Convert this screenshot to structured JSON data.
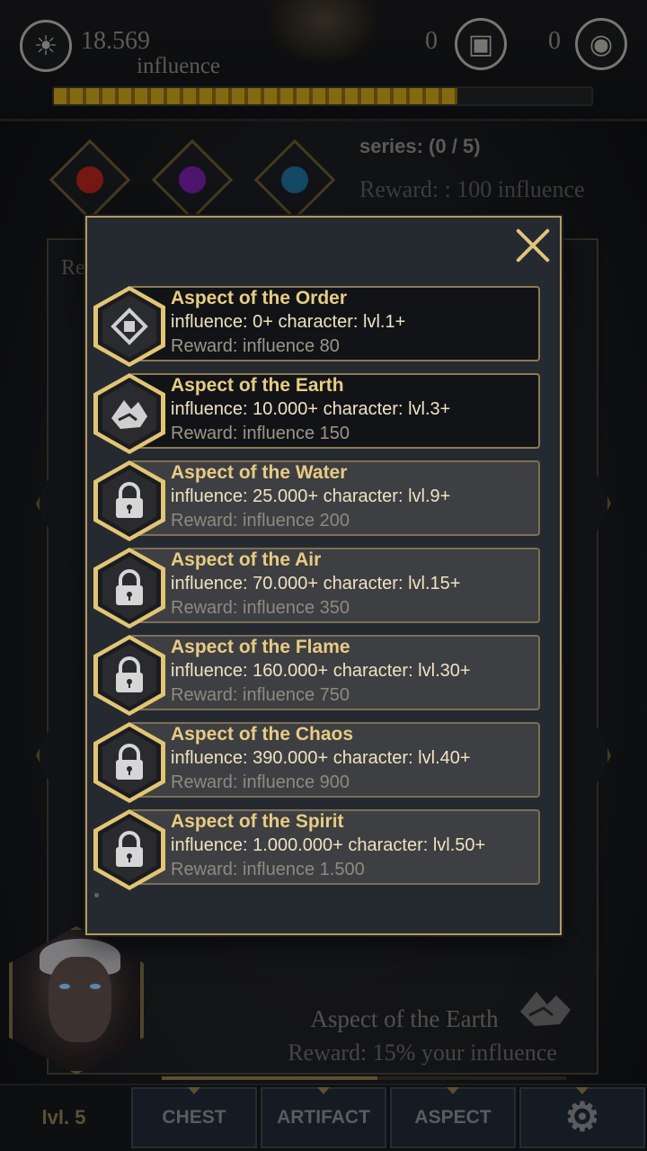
{
  "header": {
    "influence_value": "18.569",
    "influence_label": "influence",
    "chest_count": "0",
    "eye_count": "0",
    "progress": 0.75
  },
  "series": {
    "text": "series: (0 / 5)",
    "reward": "Reward: : 100 influence"
  },
  "background": {
    "aspect_name": "Aspect of the Earth",
    "aspect_reward": "Reward:  15% your influence",
    "panel_label_fragment": "Re"
  },
  "nav": {
    "level": "lvl. 5",
    "chest": "CHEST",
    "artifact": "ARTIFACT",
    "aspect": "ASPECT"
  },
  "modal": {
    "aspects": [
      {
        "title": "Aspect of the Order",
        "req": "influence: 0+ character: lvl.1+",
        "reward": "Reward: influence 80",
        "icon": "order-icon",
        "locked": false
      },
      {
        "title": "Aspect of the Earth",
        "req": "influence: 10.000+ character: lvl.3+",
        "reward": "Reward: influence 150",
        "icon": "earth-icon",
        "locked": false
      },
      {
        "title": "Aspect of the Water",
        "req": "influence: 25.000+ character: lvl.9+",
        "reward": "Reward: influence 200",
        "icon": "lock-icon",
        "locked": true
      },
      {
        "title": "Aspect of the Air",
        "req": "influence: 70.000+ character: lvl.15+",
        "reward": "Reward: influence 350",
        "icon": "lock-icon",
        "locked": true
      },
      {
        "title": "Aspect of the Flame",
        "req": "influence: 160.000+ character: lvl.30+",
        "reward": "Reward: influence 750",
        "icon": "lock-icon",
        "locked": true
      },
      {
        "title": "Aspect of the Chaos",
        "req": "influence: 390.000+ character: lvl.40+",
        "reward": "Reward: influence 900",
        "icon": "lock-icon",
        "locked": true
      },
      {
        "title": "Aspect of the Spirit",
        "req": "influence: 1.000.000+ character: lvl.50+",
        "reward": "Reward: influence 1.500",
        "icon": "lock-icon",
        "locked": true
      }
    ]
  },
  "colors": {
    "gold_accent": "#e2c574",
    "title_gold": "#e8cc83",
    "modal_bg": "#252a31"
  }
}
